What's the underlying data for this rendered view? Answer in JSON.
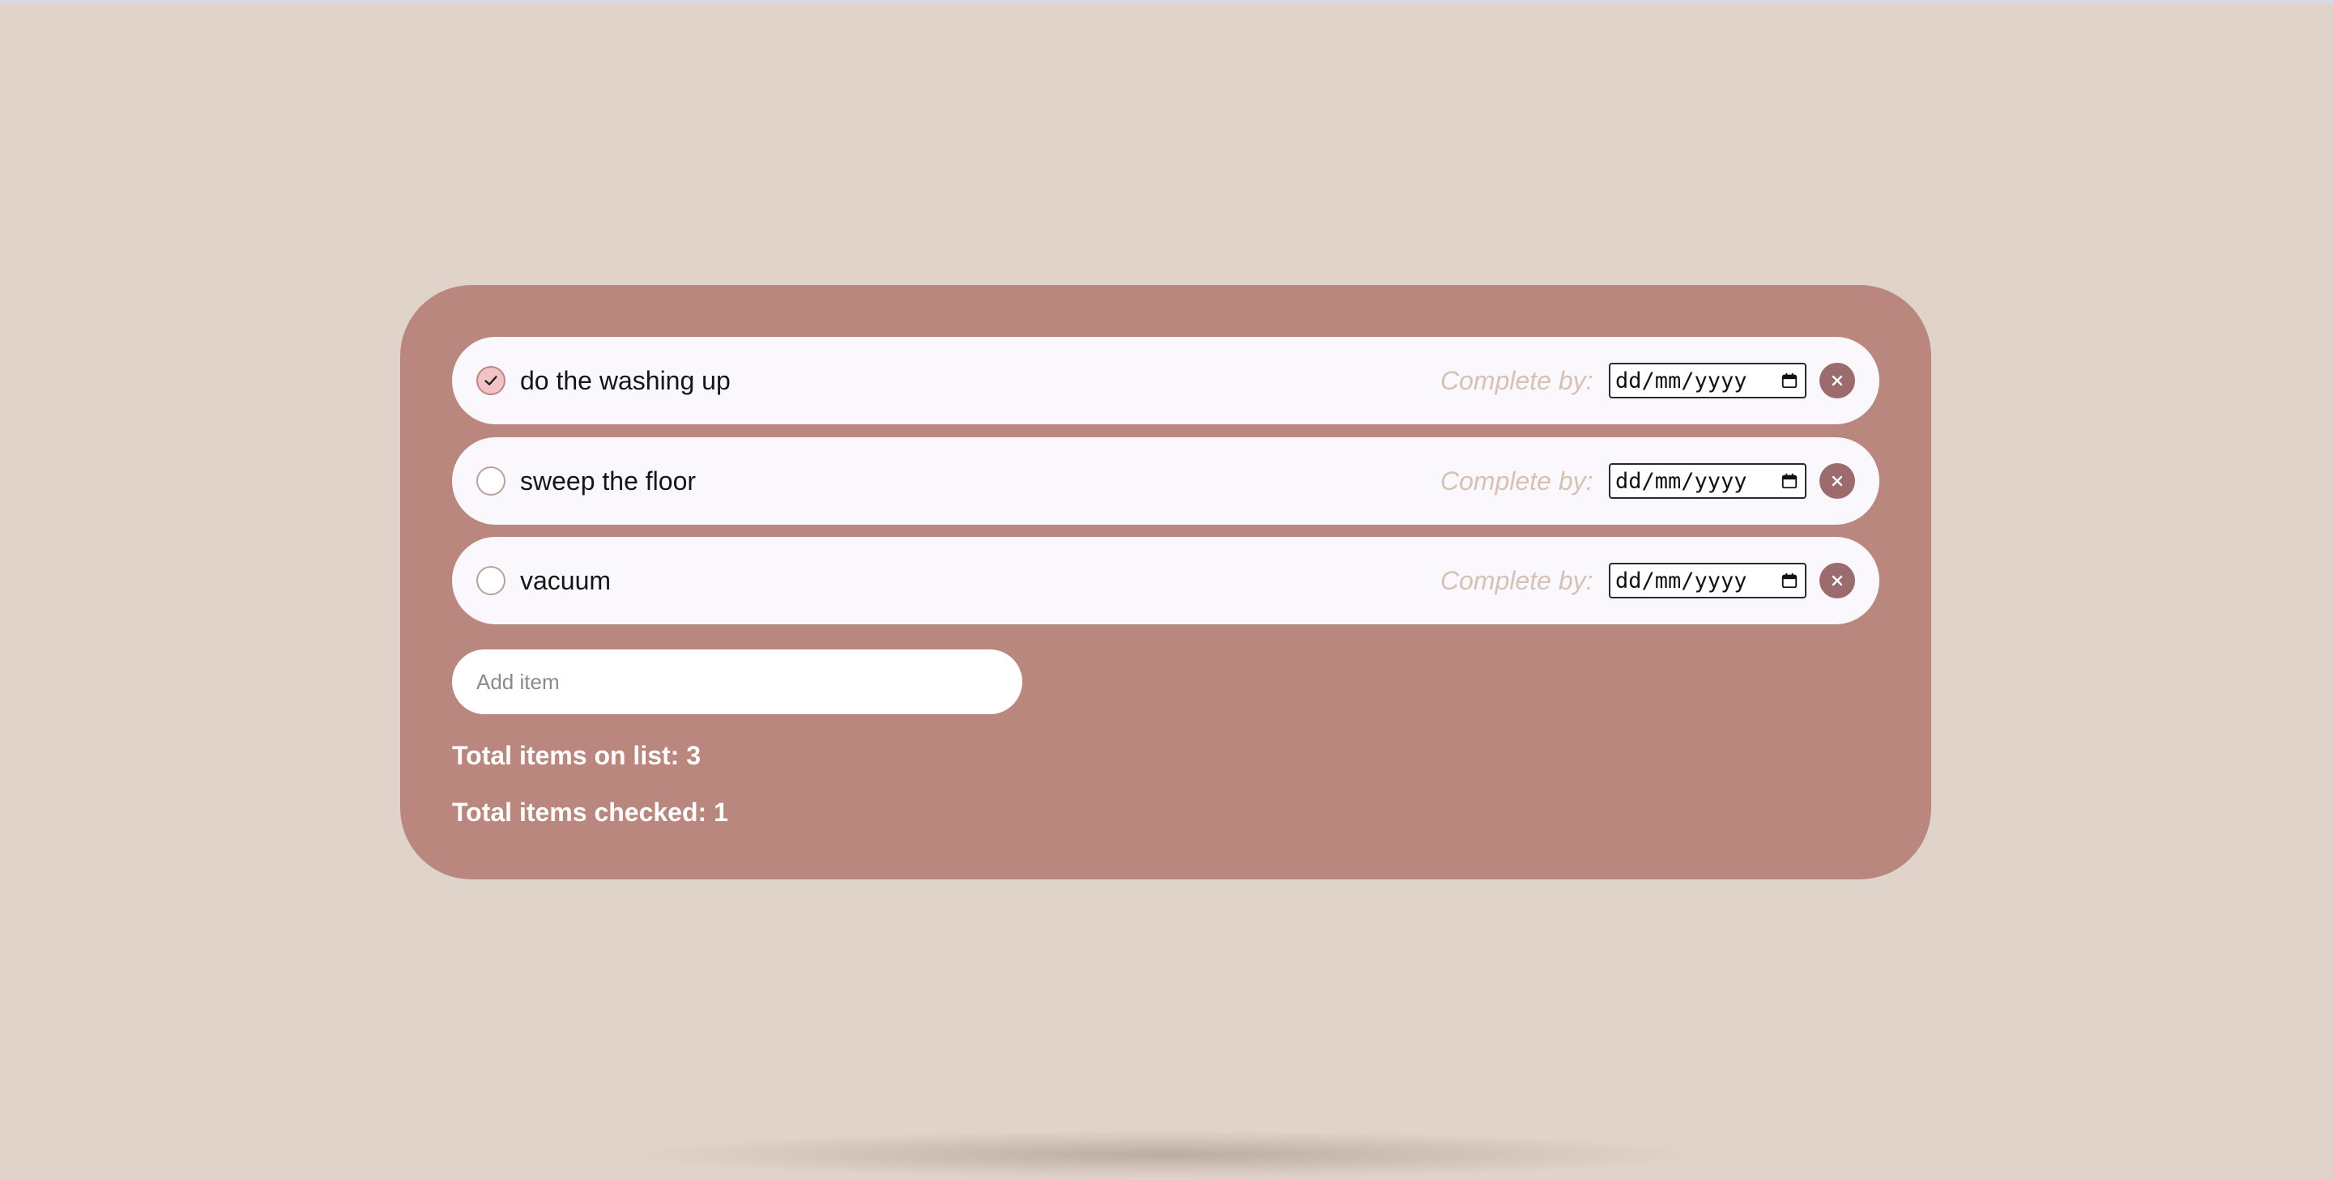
{
  "items": [
    {
      "label": "do the washing up",
      "checked": true
    },
    {
      "label": "sweep the floor",
      "checked": false
    },
    {
      "label": "vacuum",
      "checked": false
    }
  ],
  "complete_by_label": "Complete by:",
  "date_placeholder": "dd/mm/yyyy",
  "add_item": {
    "placeholder": "Add item",
    "value": ""
  },
  "stats": {
    "total_label": "Total items on list: 3",
    "checked_label": "Total items checked: 1"
  },
  "colors": {
    "background": "#e0d4ca",
    "card": "#b9877e",
    "item_bg": "#faf8fd",
    "checked_fill": "#f2c3c6",
    "remove_button": "#9b6b6e",
    "complete_by_text": "#d6c2b5"
  },
  "icons": {
    "checkbox_checked": "checkmark-icon",
    "date_picker": "calendar-icon",
    "remove": "close-icon"
  }
}
